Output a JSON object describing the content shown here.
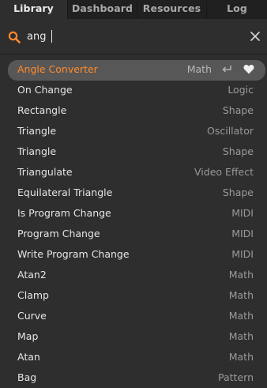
{
  "tabs": [
    {
      "label": "Library",
      "active": true
    },
    {
      "label": "Dashboard",
      "active": false
    },
    {
      "label": "Resources",
      "active": false
    },
    {
      "label": "Log",
      "active": false
    }
  ],
  "search": {
    "value": "ang",
    "icon": "search-icon",
    "clear_icon": "close-icon"
  },
  "colors": {
    "accent": "#ff8a2d",
    "panel_bg": "#2e2e2e",
    "selected_bg": "#575757"
  },
  "results": [
    {
      "name": "Angle Converter",
      "category": "Math",
      "selected": true
    },
    {
      "name": "On Change",
      "category": "Logic"
    },
    {
      "name": "Rectangle",
      "category": "Shape"
    },
    {
      "name": "Triangle",
      "category": "Oscillator"
    },
    {
      "name": "Triangle",
      "category": "Shape"
    },
    {
      "name": "Triangulate",
      "category": "Video Effect"
    },
    {
      "name": "Equilateral Triangle",
      "category": "Shape"
    },
    {
      "name": "Is Program Change",
      "category": "MIDI"
    },
    {
      "name": "Program Change",
      "category": "MIDI"
    },
    {
      "name": "Write Program Change",
      "category": "MIDI"
    },
    {
      "name": "Atan2",
      "category": "Math"
    },
    {
      "name": "Clamp",
      "category": "Math"
    },
    {
      "name": "Curve",
      "category": "Math"
    },
    {
      "name": "Map",
      "category": "Math"
    },
    {
      "name": "Atan",
      "category": "Math"
    },
    {
      "name": "Bag",
      "category": "Pattern"
    }
  ]
}
